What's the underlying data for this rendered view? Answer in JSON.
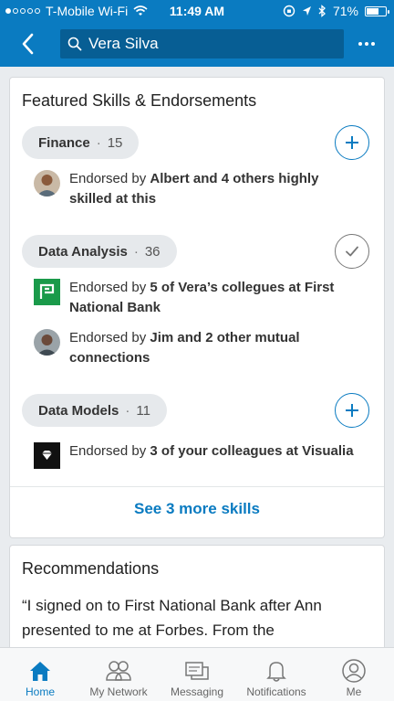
{
  "status_bar": {
    "carrier": "T-Mobile Wi-Fi",
    "time": "11:49 AM",
    "battery": "71%",
    "battery_level": 0.71
  },
  "header": {
    "search_value": "Vera Silva"
  },
  "skills_card": {
    "title": "Featured Skills & Endorsements",
    "skills": [
      {
        "name": "Finance",
        "count": "15",
        "action": "add",
        "endorsements": [
          {
            "icon": "person-avatar",
            "prefix": "Endorsed by ",
            "bold": "Albert and 4 others highly skilled at this"
          }
        ]
      },
      {
        "name": "Data Analysis",
        "count": "36",
        "action": "endorsed",
        "endorsements": [
          {
            "icon": "company-logo",
            "prefix": "Endorsed by ",
            "bold": "5 of Vera’s collegues at First National Bank"
          },
          {
            "icon": "person-avatar",
            "prefix": "Endorsed by ",
            "bold": "Jim and 2 other mutual connections"
          }
        ]
      },
      {
        "name": "Data Models",
        "count": "11",
        "action": "add",
        "endorsements": [
          {
            "icon": "company-logo",
            "prefix": "Endorsed by ",
            "bold": "3 of your colleagues at Visualia"
          }
        ]
      }
    ],
    "see_more": "See 3 more skills"
  },
  "recommendations": {
    "title": "Recommendations",
    "quote": "“I signed on to First National Bank after Ann presented to me at Forbes. From the"
  },
  "tabbar": {
    "tabs": [
      {
        "label": "Home",
        "icon": "home-icon",
        "active": true
      },
      {
        "label": "My Network",
        "icon": "network-icon"
      },
      {
        "label": "Messaging",
        "icon": "messaging-icon"
      },
      {
        "label": "Notifications",
        "icon": "bell-icon"
      },
      {
        "label": "Me",
        "icon": "profile-icon"
      }
    ]
  },
  "colors": {
    "brand_blue": "#0a7bc1",
    "search_bg": "#075e94",
    "page_bg": "#e9ecef",
    "company_green": "#1a9a4a"
  }
}
